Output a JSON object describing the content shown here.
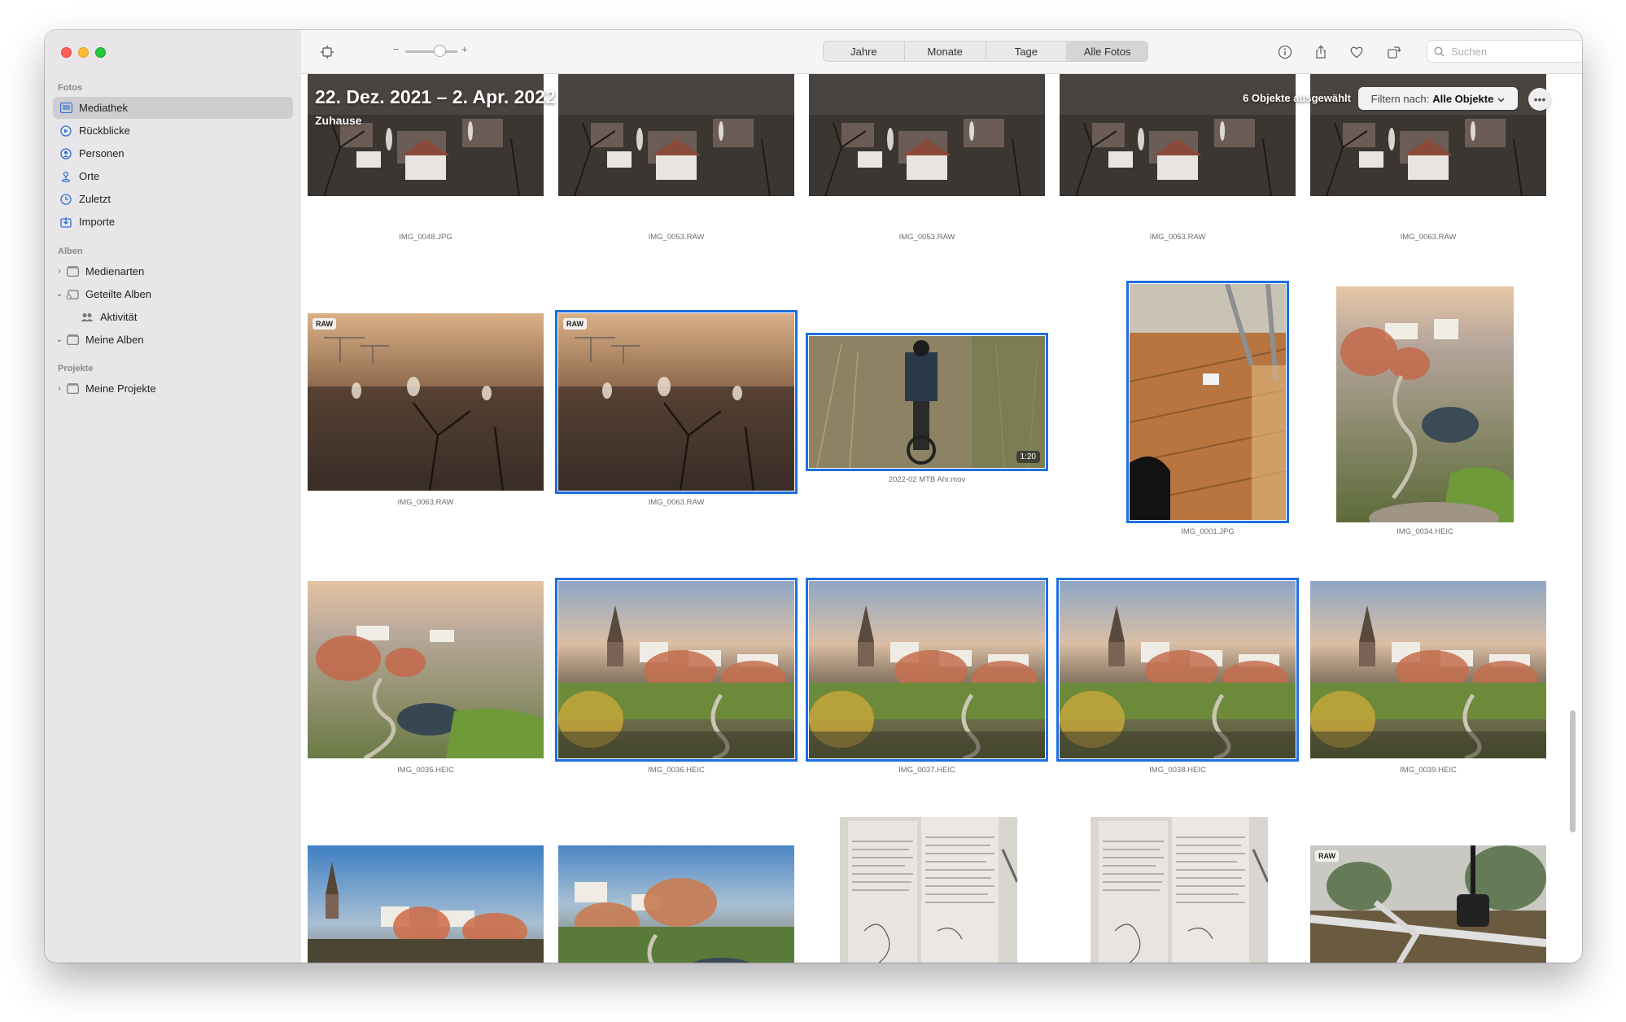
{
  "sidebar": {
    "sections": {
      "fotos": "Fotos",
      "alben": "Alben",
      "projekte": "Projekte"
    },
    "items": {
      "mediathek": "Mediathek",
      "rueckblicke": "Rückblicke",
      "personen": "Personen",
      "orte": "Orte",
      "zuletzt": "Zuletzt",
      "importe": "Importe",
      "medienarten": "Medienarten",
      "geteilte_alben": "Geteilte Alben",
      "aktivitaet": "Aktivität",
      "meine_alben": "Meine Alben",
      "meine_projekte": "Meine Projekte"
    }
  },
  "toolbar": {
    "zoom_minus": "−",
    "zoom_plus": "+",
    "zoom_level": 0.55,
    "tabs": [
      "Jahre",
      "Monate",
      "Tage",
      "Alle Fotos"
    ],
    "active_tab": "Alle Fotos",
    "search_placeholder": "Suchen"
  },
  "header": {
    "date_range": "22. Dez. 2021 – 2. Apr. 2022",
    "location": "Zuhause",
    "selection_count": "6 Objekte ausgewählt",
    "filter_label": "Filtern nach:",
    "filter_value": "Alle Objekte",
    "more_label": "•••"
  },
  "photos": [
    {
      "file": "IMG_0048.JPG",
      "selected": false
    },
    {
      "file": "IMG_0053.RAW",
      "selected": false
    },
    {
      "file": "IMG_0053.RAW",
      "selected": false
    },
    {
      "file": "IMG_0053.RAW",
      "selected": false
    },
    {
      "file": "IMG_0063.RAW",
      "selected": false
    },
    {
      "file": "IMG_0063.RAW",
      "selected": false,
      "badge": "RAW"
    },
    {
      "file": "IMG_0063.RAW",
      "selected": true,
      "badge": "RAW"
    },
    {
      "file": "2022-02 MTB Ahr.mov",
      "selected": true,
      "duration": "1:20"
    },
    {
      "file": "IMG_0001.JPG",
      "selected": true
    },
    {
      "file": "IMG_0034.HEIC",
      "selected": false
    },
    {
      "file": "IMG_0035.HEIC",
      "selected": false
    },
    {
      "file": "IMG_0036.HEIC",
      "selected": true
    },
    {
      "file": "IMG_0037.HEIC",
      "selected": true
    },
    {
      "file": "IMG_0038.HEIC",
      "selected": true
    },
    {
      "file": "IMG_0039.HEIC",
      "selected": false
    },
    {
      "selected": false
    },
    {
      "selected": false
    },
    {
      "selected": false
    },
    {
      "selected": false
    },
    {
      "selected": false,
      "badge": "RAW"
    }
  ],
  "colors": {
    "selection": "#1e6fe0",
    "sidebar_bg": "#e8e6e8",
    "sidebar_selected": "#cfcdcf"
  }
}
